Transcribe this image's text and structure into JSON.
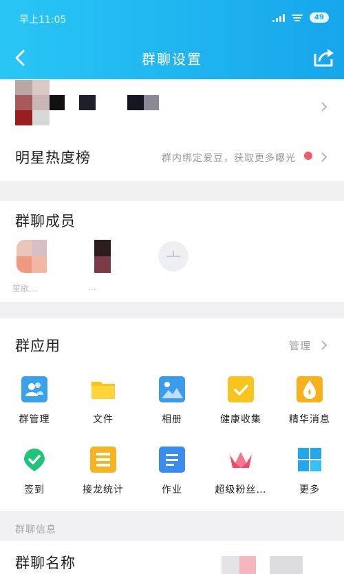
{
  "status": {
    "time": "早上11:05",
    "battery": "49"
  },
  "nav": {
    "title": "群聊设置"
  },
  "ranking": {
    "title": "明星热度榜",
    "description": "群内绑定爱豆，获取更多曝光"
  },
  "members": {
    "title": "群聊成员",
    "names": [
      "笙歌…",
      "…",
      ""
    ]
  },
  "apps": {
    "title": "群应用",
    "manage": "管理",
    "items": [
      {
        "label": "群管理",
        "icon": "group-manage-icon",
        "color": "#3aa2e6"
      },
      {
        "label": "文件",
        "icon": "folder-icon",
        "color": "#fcc419"
      },
      {
        "label": "相册",
        "icon": "photo-album-icon",
        "color": "#3b9cec"
      },
      {
        "label": "健康收集",
        "icon": "health-collect-icon",
        "color": "#f7c51d"
      },
      {
        "label": "精华消息",
        "icon": "essence-message-icon",
        "color": "#f6b21c"
      },
      {
        "label": "签到",
        "icon": "check-in-icon",
        "color": "#22c47a"
      },
      {
        "label": "接龙统计",
        "icon": "relay-stats-icon",
        "color": "#f5b522"
      },
      {
        "label": "作业",
        "icon": "homework-icon",
        "color": "#3b8ded"
      },
      {
        "label": "超级粉丝…",
        "icon": "super-fans-icon",
        "color": "#f3486a"
      },
      {
        "label": "更多",
        "icon": "more-apps-icon",
        "color": "#23a6ec"
      }
    ]
  },
  "info": {
    "section_title": "群聊信息",
    "group_name_label": "群聊名称"
  }
}
